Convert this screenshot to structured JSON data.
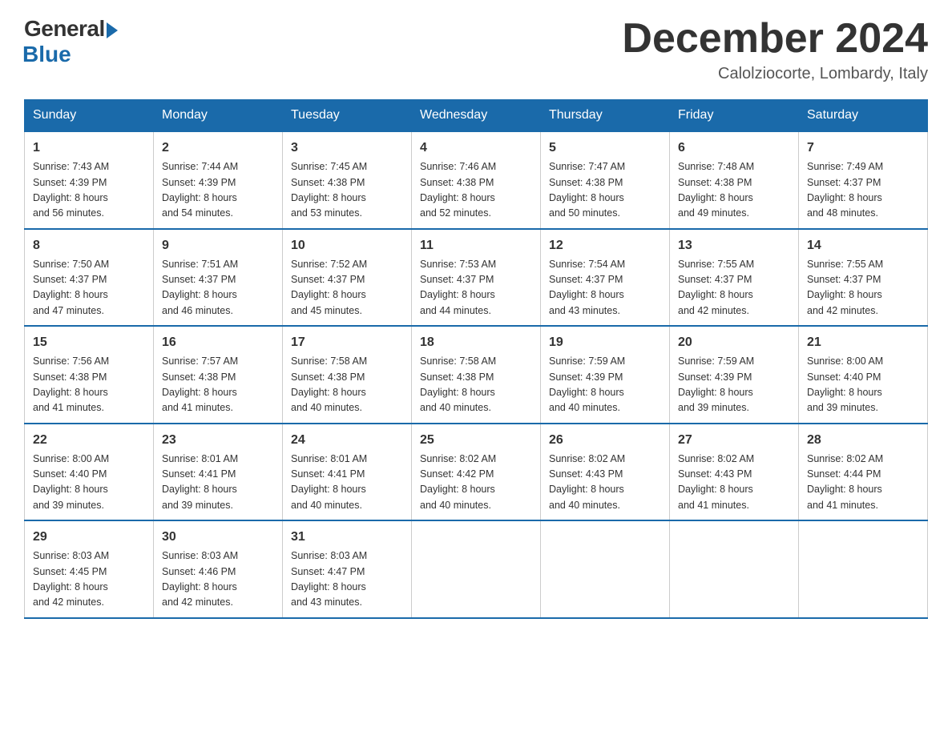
{
  "header": {
    "logo_general": "General",
    "logo_blue": "Blue",
    "month_title": "December 2024",
    "location": "Calolziocorte, Lombardy, Italy"
  },
  "days_of_week": [
    "Sunday",
    "Monday",
    "Tuesday",
    "Wednesday",
    "Thursday",
    "Friday",
    "Saturday"
  ],
  "weeks": [
    [
      {
        "day": "1",
        "sunrise": "7:43 AM",
        "sunset": "4:39 PM",
        "daylight_hours": "8",
        "daylight_minutes": "56"
      },
      {
        "day": "2",
        "sunrise": "7:44 AM",
        "sunset": "4:39 PM",
        "daylight_hours": "8",
        "daylight_minutes": "54"
      },
      {
        "day": "3",
        "sunrise": "7:45 AM",
        "sunset": "4:38 PM",
        "daylight_hours": "8",
        "daylight_minutes": "53"
      },
      {
        "day": "4",
        "sunrise": "7:46 AM",
        "sunset": "4:38 PM",
        "daylight_hours": "8",
        "daylight_minutes": "52"
      },
      {
        "day": "5",
        "sunrise": "7:47 AM",
        "sunset": "4:38 PM",
        "daylight_hours": "8",
        "daylight_minutes": "50"
      },
      {
        "day": "6",
        "sunrise": "7:48 AM",
        "sunset": "4:38 PM",
        "daylight_hours": "8",
        "daylight_minutes": "49"
      },
      {
        "day": "7",
        "sunrise": "7:49 AM",
        "sunset": "4:37 PM",
        "daylight_hours": "8",
        "daylight_minutes": "48"
      }
    ],
    [
      {
        "day": "8",
        "sunrise": "7:50 AM",
        "sunset": "4:37 PM",
        "daylight_hours": "8",
        "daylight_minutes": "47"
      },
      {
        "day": "9",
        "sunrise": "7:51 AM",
        "sunset": "4:37 PM",
        "daylight_hours": "8",
        "daylight_minutes": "46"
      },
      {
        "day": "10",
        "sunrise": "7:52 AM",
        "sunset": "4:37 PM",
        "daylight_hours": "8",
        "daylight_minutes": "45"
      },
      {
        "day": "11",
        "sunrise": "7:53 AM",
        "sunset": "4:37 PM",
        "daylight_hours": "8",
        "daylight_minutes": "44"
      },
      {
        "day": "12",
        "sunrise": "7:54 AM",
        "sunset": "4:37 PM",
        "daylight_hours": "8",
        "daylight_minutes": "43"
      },
      {
        "day": "13",
        "sunrise": "7:55 AM",
        "sunset": "4:37 PM",
        "daylight_hours": "8",
        "daylight_minutes": "42"
      },
      {
        "day": "14",
        "sunrise": "7:55 AM",
        "sunset": "4:37 PM",
        "daylight_hours": "8",
        "daylight_minutes": "42"
      }
    ],
    [
      {
        "day": "15",
        "sunrise": "7:56 AM",
        "sunset": "4:38 PM",
        "daylight_hours": "8",
        "daylight_minutes": "41"
      },
      {
        "day": "16",
        "sunrise": "7:57 AM",
        "sunset": "4:38 PM",
        "daylight_hours": "8",
        "daylight_minutes": "41"
      },
      {
        "day": "17",
        "sunrise": "7:58 AM",
        "sunset": "4:38 PM",
        "daylight_hours": "8",
        "daylight_minutes": "40"
      },
      {
        "day": "18",
        "sunrise": "7:58 AM",
        "sunset": "4:38 PM",
        "daylight_hours": "8",
        "daylight_minutes": "40"
      },
      {
        "day": "19",
        "sunrise": "7:59 AM",
        "sunset": "4:39 PM",
        "daylight_hours": "8",
        "daylight_minutes": "40"
      },
      {
        "day": "20",
        "sunrise": "7:59 AM",
        "sunset": "4:39 PM",
        "daylight_hours": "8",
        "daylight_minutes": "39"
      },
      {
        "day": "21",
        "sunrise": "8:00 AM",
        "sunset": "4:40 PM",
        "daylight_hours": "8",
        "daylight_minutes": "39"
      }
    ],
    [
      {
        "day": "22",
        "sunrise": "8:00 AM",
        "sunset": "4:40 PM",
        "daylight_hours": "8",
        "daylight_minutes": "39"
      },
      {
        "day": "23",
        "sunrise": "8:01 AM",
        "sunset": "4:41 PM",
        "daylight_hours": "8",
        "daylight_minutes": "39"
      },
      {
        "day": "24",
        "sunrise": "8:01 AM",
        "sunset": "4:41 PM",
        "daylight_hours": "8",
        "daylight_minutes": "40"
      },
      {
        "day": "25",
        "sunrise": "8:02 AM",
        "sunset": "4:42 PM",
        "daylight_hours": "8",
        "daylight_minutes": "40"
      },
      {
        "day": "26",
        "sunrise": "8:02 AM",
        "sunset": "4:43 PM",
        "daylight_hours": "8",
        "daylight_minutes": "40"
      },
      {
        "day": "27",
        "sunrise": "8:02 AM",
        "sunset": "4:43 PM",
        "daylight_hours": "8",
        "daylight_minutes": "41"
      },
      {
        "day": "28",
        "sunrise": "8:02 AM",
        "sunset": "4:44 PM",
        "daylight_hours": "8",
        "daylight_minutes": "41"
      }
    ],
    [
      {
        "day": "29",
        "sunrise": "8:03 AM",
        "sunset": "4:45 PM",
        "daylight_hours": "8",
        "daylight_minutes": "42"
      },
      {
        "day": "30",
        "sunrise": "8:03 AM",
        "sunset": "4:46 PM",
        "daylight_hours": "8",
        "daylight_minutes": "42"
      },
      {
        "day": "31",
        "sunrise": "8:03 AM",
        "sunset": "4:47 PM",
        "daylight_hours": "8",
        "daylight_minutes": "43"
      },
      null,
      null,
      null,
      null
    ]
  ]
}
